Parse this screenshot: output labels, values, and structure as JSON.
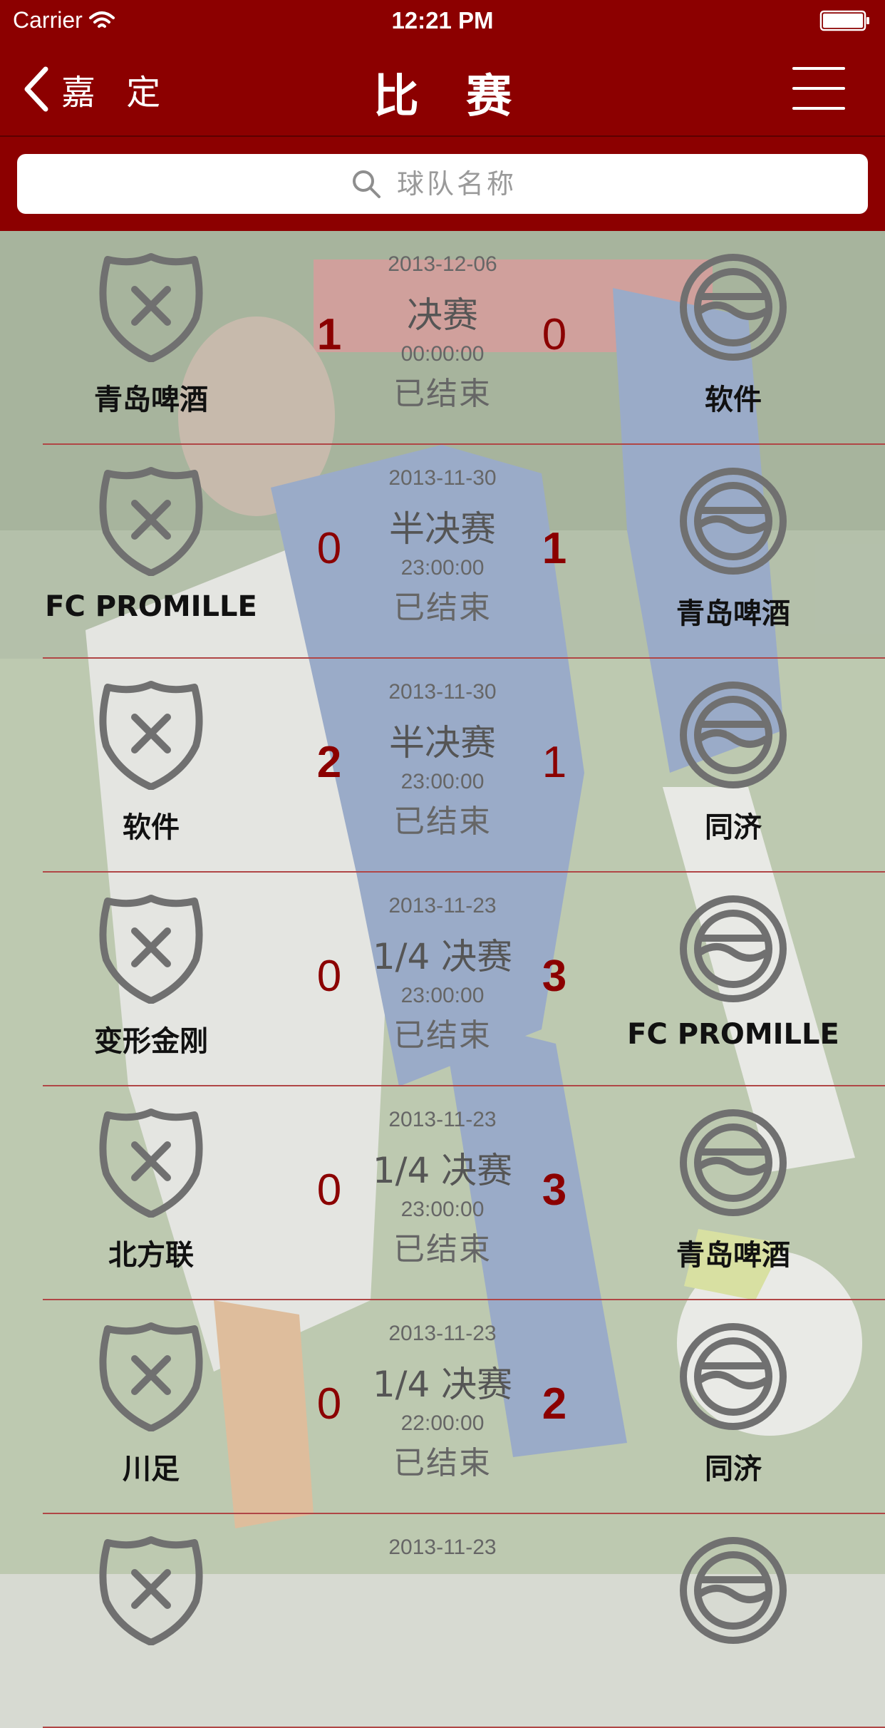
{
  "status_bar": {
    "carrier": "Carrier",
    "time": "12:21 PM"
  },
  "nav": {
    "back_label": "嘉 定",
    "title": "比 赛"
  },
  "search": {
    "placeholder": "球队名称"
  },
  "colors": {
    "brand": "#8c0000",
    "score": "#8b0000",
    "divider": "#b04646"
  },
  "icons": {
    "home_logo": "shield-cross-icon",
    "away_logo": "circle-wave-icon"
  },
  "matches": [
    {
      "date": "2013-12-06",
      "stage": "决赛",
      "time": "00:00:00",
      "status": "已结束",
      "home": "青岛啤酒",
      "home_score": "1",
      "away": "软件",
      "away_score": "0"
    },
    {
      "date": "2013-11-30",
      "stage": "半决赛",
      "time": "23:00:00",
      "status": "已结束",
      "home": "FC PROMILLE",
      "home_score": "0",
      "away": "青岛啤酒",
      "away_score": "1"
    },
    {
      "date": "2013-11-30",
      "stage": "半决赛",
      "time": "23:00:00",
      "status": "已结束",
      "home": "软件",
      "home_score": "2",
      "away": "同济",
      "away_score": "1"
    },
    {
      "date": "2013-11-23",
      "stage": "1/4 决赛",
      "time": "23:00:00",
      "status": "已结束",
      "home": "变形金刚",
      "home_score": "0",
      "away": "FC PROMILLE",
      "away_score": "3"
    },
    {
      "date": "2013-11-23",
      "stage": "1/4 决赛",
      "time": "23:00:00",
      "status": "已结束",
      "home": "北方联",
      "home_score": "0",
      "away": "青岛啤酒",
      "away_score": "3"
    },
    {
      "date": "2013-11-23",
      "stage": "1/4 决赛",
      "time": "22:00:00",
      "status": "已结束",
      "home": "川足",
      "home_score": "0",
      "away": "同济",
      "away_score": "2"
    },
    {
      "date": "2013-11-23"
    }
  ]
}
